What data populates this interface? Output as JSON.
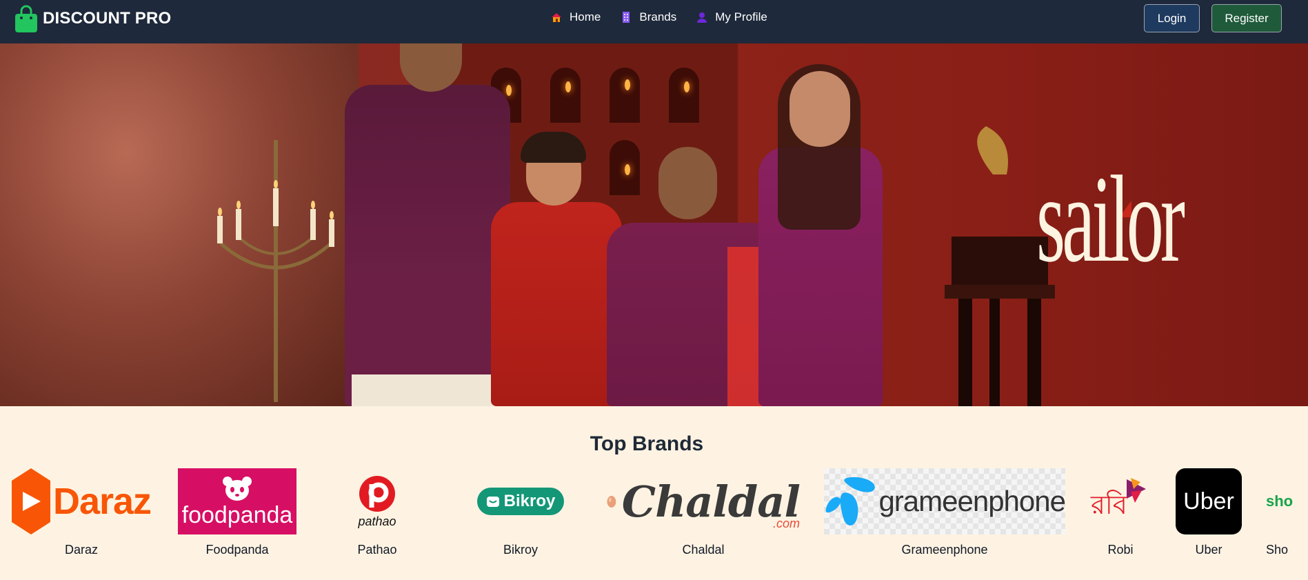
{
  "navbar": {
    "brand": "DISCOUNT PRO",
    "links": [
      {
        "label": "Home",
        "icon": "house-icon"
      },
      {
        "label": "Brands",
        "icon": "building-icon"
      },
      {
        "label": "My Profile",
        "icon": "user-icon"
      }
    ],
    "login_label": "Login",
    "register_label": "Register"
  },
  "hero": {
    "logo_text": "sailor"
  },
  "top_brands": {
    "title": "Top Brands",
    "items": [
      {
        "name": "Daraz",
        "logo_text": "Daraz"
      },
      {
        "name": "Foodpanda",
        "logo_text": "foodpanda"
      },
      {
        "name": "Pathao",
        "logo_text": "pathao"
      },
      {
        "name": "Bikroy",
        "logo_text": "Bikroy"
      },
      {
        "name": "Chaldal",
        "logo_text": "Chaldal",
        "logo_sub": ".com"
      },
      {
        "name": "Grameenphone",
        "logo_text": "grameenphone"
      },
      {
        "name": "Robi",
        "logo_text": "রবি"
      },
      {
        "name": "Uber",
        "logo_text": "Uber"
      },
      {
        "name": "Sho",
        "logo_text": "sho"
      }
    ]
  },
  "colors": {
    "navbar": "#1e293b",
    "page_bg": "#fef3e2",
    "brand_green": "#22c55e",
    "daraz": "#f85606",
    "foodpanda": "#d70f64",
    "bikroy": "#149777",
    "grameenphone": "#19aaf8"
  }
}
